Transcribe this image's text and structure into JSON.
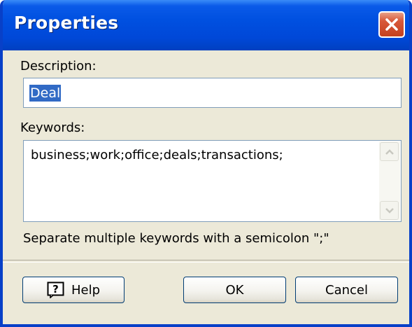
{
  "window": {
    "title": "Properties"
  },
  "description": {
    "label": "Description:",
    "value": "Deal"
  },
  "keywords": {
    "label": "Keywords:",
    "value": "business;work;office;deals;transactions;",
    "hint": "Separate multiple keywords with a semicolon \";\""
  },
  "buttons": {
    "help": "Help",
    "ok": "OK",
    "cancel": "Cancel"
  },
  "icons": {
    "close": "close-icon",
    "help": "help-icon",
    "scroll_up": "chevron-up-icon",
    "scroll_down": "chevron-down-icon"
  },
  "colors": {
    "titlebar": "#0050e0",
    "close_button": "#d8593a",
    "selection": "#316ac5",
    "dialog_face": "#ece9d8"
  }
}
